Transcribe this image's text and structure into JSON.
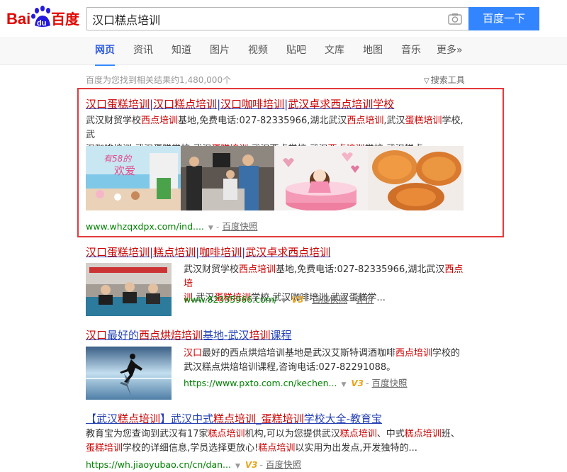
{
  "header": {
    "logo_text_bai": "Bai",
    "logo_text_du": "du",
    "logo_text_cn": "百度",
    "search_value": "汉口糕点培训",
    "search_button": "百度一下"
  },
  "nav": {
    "tabs": [
      {
        "label": "网页"
      },
      {
        "label": "资讯"
      },
      {
        "label": "知道"
      },
      {
        "label": "图片"
      },
      {
        "label": "视频"
      },
      {
        "label": "贴吧"
      },
      {
        "label": "文库"
      },
      {
        "label": "地图"
      },
      {
        "label": "音乐"
      },
      {
        "label": "更多»"
      }
    ]
  },
  "stats": {
    "text": "百度为您找到相关结果约1,480,000个",
    "tools": "搜索工具"
  },
  "results": [
    {
      "title": [
        "汉口蛋糕培训",
        "|",
        "汉口糕点培训",
        "|",
        "汉口咖啡培训",
        "|",
        "武汉卓求西点培训学校"
      ],
      "abstract_l1": [
        "武汉财贸学校",
        "西点培训",
        "基地,免费电话:027-82335966,湖北武汉",
        "西点培训",
        ",武汉",
        "蛋糕培训",
        "学校,武"
      ],
      "abstract_l2": [
        "汉咖啡培训,武汉蛋糕学校,武汉",
        "蛋糕培训",
        ",武汉西点学校,武汉",
        "西点培训",
        "学校,武汉糕点..."
      ],
      "url": "www.whzqxdpx.com/ind....",
      "snapshot": "百度快照"
    },
    {
      "title": [
        "汉口蛋糕培训",
        "|",
        "糕点培训",
        "|",
        "咖啡培训",
        "|",
        "武汉卓求西点培训"
      ],
      "abstract_l1": [
        "武汉财贸学校",
        "西点培训",
        "基地,免费电话:027-82335966,湖北武汉",
        "西点培"
      ],
      "abstract_l2": [
        "训",
        ",武汉",
        "蛋糕培训",
        "学校,武汉咖啡培训,武汉蛋糕学..."
      ],
      "url": "www.82335966.com/",
      "snapshot": "百度快照",
      "review": "评价"
    },
    {
      "title": [
        "汉口",
        "最好的",
        "西点烘焙培训",
        "基地-武汉",
        "培训",
        "课程"
      ],
      "abstract_l1": [
        "汉口",
        "最好的西点烘焙培训基地是武汉艾斯特调酒咖啡",
        "西点培训",
        "学校的"
      ],
      "abstract_l2": [
        "武汉糕点烘焙培训课程,咨询电话:027-82291088。"
      ],
      "url": "https://www.pxto.com.cn/kechen...",
      "snapshot": "百度快照"
    },
    {
      "title": [
        "【武汉",
        "糕点培训",
        "】武汉中式",
        "糕点培训",
        "_",
        "蛋糕培训",
        "学校大全-教育宝"
      ],
      "abstract_l1": [
        "教育宝为您查询到武汉有17家",
        "糕点培训",
        "机构,可以为您提供武汉",
        "糕点培训",
        "、中式",
        "糕点培训",
        "班、"
      ],
      "abstract_l2": [
        "蛋糕培训",
        "学校的详细信息,学员选择更放心!",
        "糕点培训",
        "以实用为出发点,开发独特的..."
      ],
      "url": "https://wh.jiaoyubao.cn/cn/dan...",
      "snapshot": "百度快照"
    }
  ],
  "colors": {
    "accent": "#3385ff",
    "title_link": "#2440b3",
    "highlight": "#cc0000",
    "url_green": "#008000",
    "box_red": "#e4393c"
  }
}
